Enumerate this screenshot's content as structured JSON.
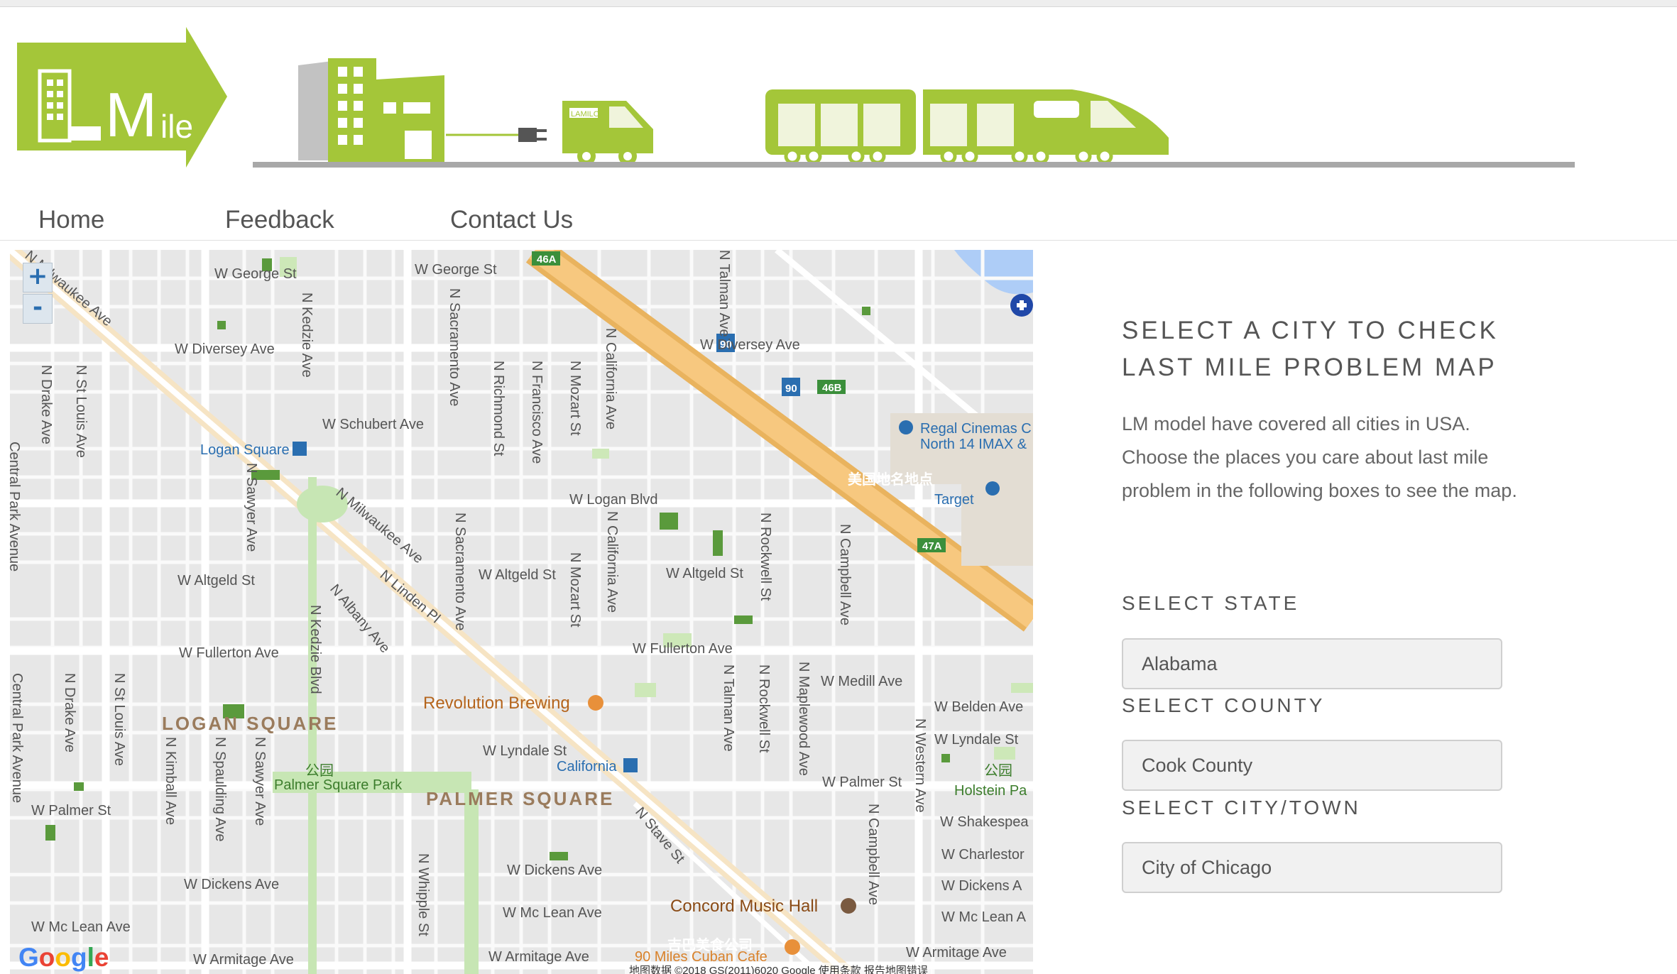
{
  "colors": {
    "brand_green": "#a4c639",
    "rail_gray": "#a8a8a8",
    "nav_text": "#555555"
  },
  "logo": {
    "text": "LMile"
  },
  "truck": {
    "label": "LAMILO"
  },
  "nav": {
    "home": "Home",
    "feedback": "Feedback",
    "contact": "Contact Us"
  },
  "map": {
    "zoom_in": "+",
    "zoom_out": "-",
    "streets": [
      "W George St",
      "W George St",
      "W Diversey Ave",
      "W Diversey Ave",
      "W Schubert Ave",
      "W Logan Blvd",
      "W Altgeld St",
      "W Altgeld St",
      "W Altgeld St",
      "W Fullerton Ave",
      "W Fullerton Ave",
      "W Medill Ave",
      "W Belden Ave",
      "W Lyndale St",
      "W Lyndale St",
      "W Palmer St",
      "W Palmer St",
      "W Shakespea",
      "W Charlestor",
      "W Dickens Ave",
      "W Dickens Ave",
      "W Dickens A",
      "W Mc Lean Ave",
      "W Mc Lean Ave",
      "W Mc Lean A",
      "W Armitage Ave",
      "W Armitage Ave",
      "W Armitage Ave",
      "N Milwaukee Ave",
      "N Milwaukee Ave",
      "N Linden Pl",
      "N Albany Ave",
      "N Stave St",
      "N Drake Ave",
      "N St Louis Ave",
      "N Kedzie Ave",
      "N Sawyer Ave",
      "N Sacramento Ave",
      "N Sacramento Ave",
      "N Richmond St",
      "N Francisco Ave",
      "N Mozart St",
      "N Mozart St",
      "N California Ave",
      "N California Ave",
      "N Talman Ave",
      "N Talman Ave",
      "N Rockwell St",
      "N Rockwell St",
      "N Campbell Ave",
      "N Campbell Ave",
      "N Maplewood Ave",
      "N Western Ave",
      "N Kedzie Blvd",
      "N Kimball Ave",
      "N Spaulding Ave",
      "N Whipple St",
      "N Drake Ave",
      "N St Louis Ave",
      "N Sawyer Ave",
      "Central Park Avenue",
      "Central Park Avenue"
    ],
    "neighborhoods": [
      "LOGAN SQUARE",
      "PALMER SQUARE"
    ],
    "pois": [
      "Logan Square",
      "California",
      "Revolution Brewing",
      "Concord Music Hall",
      "90 Miles Cuban Cafe",
      "Regal Cinemas C",
      "North 14 IMAX &",
      "Target",
      "Palmer Square Park",
      "Holstein Pa"
    ],
    "park_glyphs": [
      "公园",
      "公园"
    ],
    "overlay_text": [
      "美国地名地点",
      "吉巴美食公司"
    ],
    "highway": [
      "46A",
      "90",
      "90",
      "46B",
      "47A"
    ],
    "google": "Google",
    "attribution": "地图数据 ©2018 GS(2011)6020 Google    使用条款    报告地图错误"
  },
  "panel": {
    "title_line1": "SELECT A CITY TO CHECK",
    "title_line2": "LAST MILE PROBLEM MAP",
    "description": "LM model have covered all cities in USA. Choose the places you care about last mile problem in the following boxes to see the map.",
    "state_label": "SELECT STATE",
    "state_value": "Alabama",
    "county_label": "SELECT COUNTY",
    "county_value": "Cook County",
    "city_label": "SELECT CITY/TOWN",
    "city_value": "City of Chicago"
  }
}
